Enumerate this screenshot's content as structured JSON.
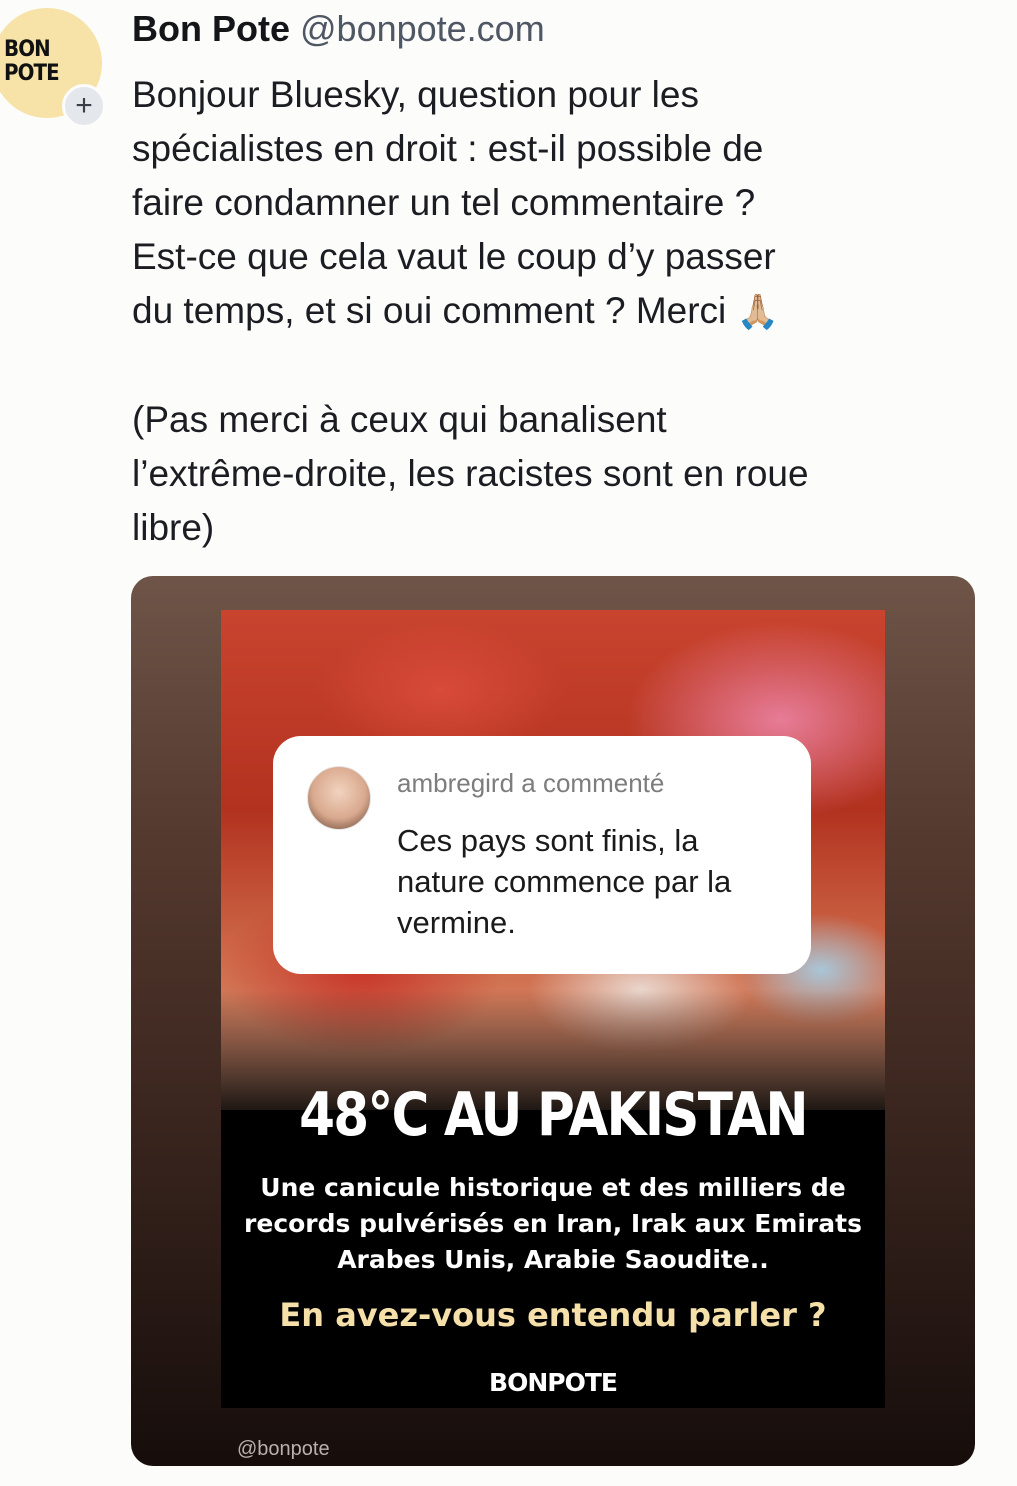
{
  "author": {
    "display_name": "Bon Pote",
    "handle": "@bonpote.com",
    "avatar_text_line1": "BON",
    "avatar_text_line2": "POTE",
    "follow_symbol": "+"
  },
  "post": {
    "text": "Bonjour Bluesky, question pour les\nspécialistes en droit : est-il possible de\nfaire condamner un tel commentaire ?\nEst-ce que cela vaut le coup d’y passer\ndu temps, et si oui comment ? Merci ",
    "emoji": "🙏🏼",
    "text2": "\n\n(Pas merci à ceux qui banalisent\nl’extrême-droite, les racistes sont en roue\nlibre)"
  },
  "embed": {
    "comment": {
      "username_line": "ambregird a commenté",
      "text": "Ces pays sont finis, la\nnature commence par la\nvermine."
    },
    "headline": "48°C AU PAKISTAN",
    "subtext": "Une canicule historique et des milliers de\nrecords pulvérisés en Iran, Irak aux Emirats\nArabes Unis, Arabie Saoudite..",
    "question": "En avez-vous entendu parler ?",
    "brand": "BONPOTE",
    "handle": "@bonpote"
  }
}
